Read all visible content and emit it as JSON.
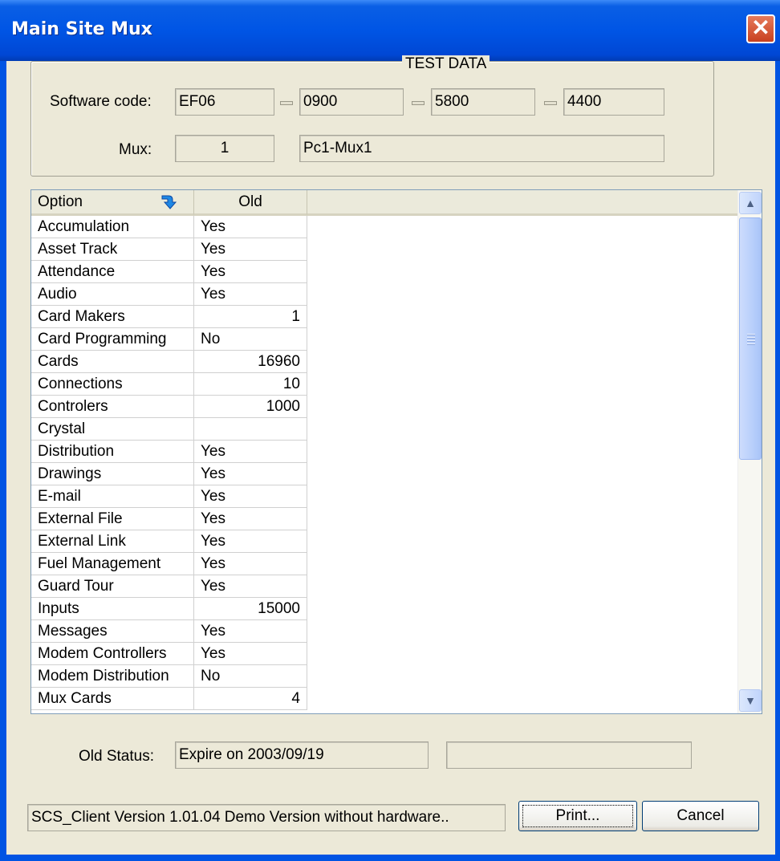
{
  "window": {
    "title": "Main Site Mux",
    "close_glyph": "✕"
  },
  "test_data": {
    "group_title": "TEST DATA",
    "software_code_label": "Software code:",
    "software_code": [
      "EF06",
      "0900",
      "5800",
      "4400"
    ],
    "mux_label": "Mux:",
    "mux_number": "1",
    "mux_name": "Pc1-Mux1"
  },
  "table": {
    "columns": [
      "Option",
      "Old"
    ],
    "rows": [
      {
        "option": "Accumulation",
        "old": "Yes"
      },
      {
        "option": "Asset Track",
        "old": "Yes"
      },
      {
        "option": "Attendance",
        "old": "Yes"
      },
      {
        "option": "Audio",
        "old": "Yes"
      },
      {
        "option": "Card Makers",
        "old": "1"
      },
      {
        "option": "Card Programming",
        "old": "No"
      },
      {
        "option": "Cards",
        "old": "16960"
      },
      {
        "option": "Connections",
        "old": "10"
      },
      {
        "option": "Controlers",
        "old": "1000"
      },
      {
        "option": "Crystal",
        "old": ""
      },
      {
        "option": "Distribution",
        "old": "Yes"
      },
      {
        "option": "Drawings",
        "old": "Yes"
      },
      {
        "option": "E-mail",
        "old": "Yes"
      },
      {
        "option": "External File",
        "old": "Yes"
      },
      {
        "option": "External Link",
        "old": "Yes"
      },
      {
        "option": "Fuel Management",
        "old": "Yes"
      },
      {
        "option": "Guard Tour",
        "old": "Yes"
      },
      {
        "option": "Inputs",
        "old": "15000"
      },
      {
        "option": "Messages",
        "old": "Yes"
      },
      {
        "option": "Modem Controllers",
        "old": "Yes"
      },
      {
        "option": "Modem Distribution",
        "old": "No"
      },
      {
        "option": "Mux Cards",
        "old": "4"
      }
    ]
  },
  "status": {
    "label": "Old Status:",
    "value": "Expire on 2003/09/19",
    "extra": ""
  },
  "footer": {
    "version_text": "SCS_Client Version 1.01.04 Demo Version without hardware..",
    "print_label": "Print...",
    "cancel_label": "Cancel"
  }
}
